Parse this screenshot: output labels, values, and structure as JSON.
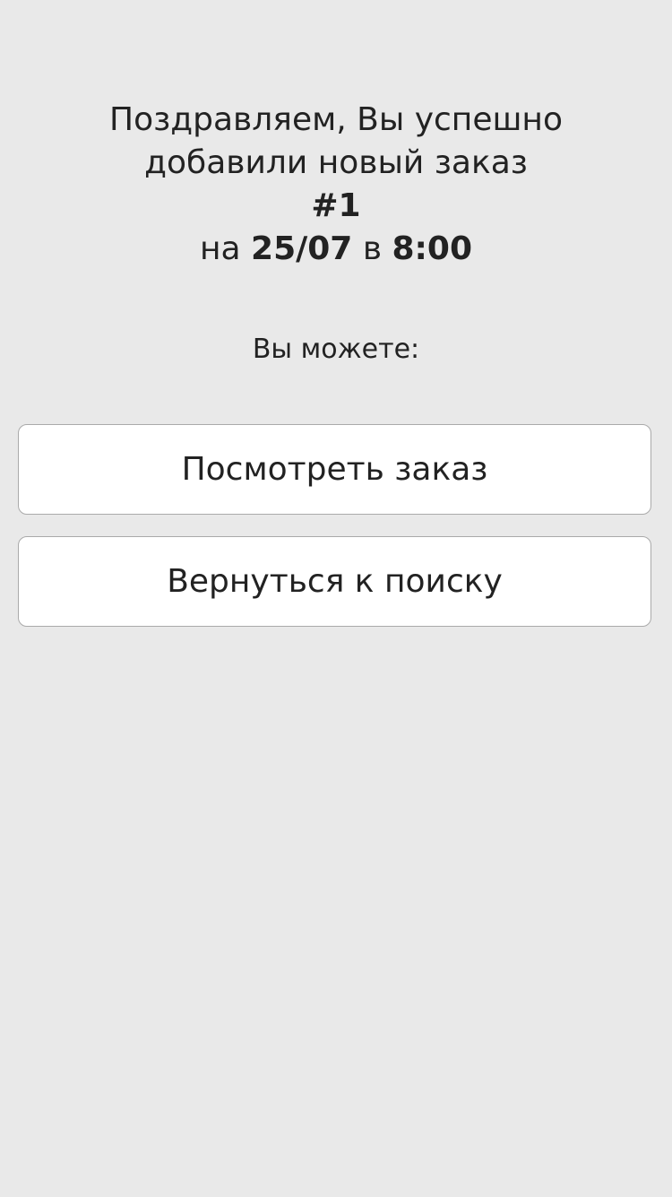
{
  "message": {
    "line1": "Поздравляем, Вы успешно",
    "line2": "добавили новый заказ",
    "order_number": "#1",
    "date_prefix": "на",
    "date": "25/07",
    "time_prefix": "в",
    "time": "8:00"
  },
  "options_label": "Вы можете:",
  "buttons": {
    "view_order": "Посмотреть заказ",
    "back_to_search": "Вернуться к поиску"
  }
}
